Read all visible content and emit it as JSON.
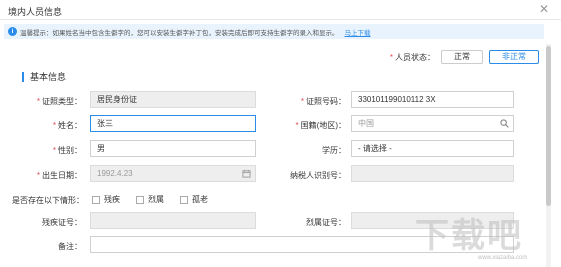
{
  "dialog": {
    "title": "境内人员信息",
    "close_glyph": "✕"
  },
  "notice": {
    "icon_glyph": "i",
    "text": "温馨提示：如果姓名当中包含生僻字的，您可以安装生僻字补丁包，安装完成后即可支持生僻字的录入和显示。",
    "link": "马上下载"
  },
  "status": {
    "label": "人员状态：",
    "options": [
      "正常",
      "非正常"
    ],
    "selected": "非正常"
  },
  "section_title": "基本信息",
  "form": {
    "id_type": {
      "label": "证照类型：",
      "value": "居民身份证",
      "required": true
    },
    "id_number": {
      "label": "证照号码：",
      "value": "330101199010112 3X",
      "required": true
    },
    "name": {
      "label": "姓名：",
      "value": "张三",
      "required": true
    },
    "nationality": {
      "label": "国籍(地区)：",
      "value": "中国",
      "required": true,
      "icon": "search-icon"
    },
    "gender": {
      "label": "性别：",
      "value": "男",
      "required": true
    },
    "education": {
      "label": "学历：",
      "value": "- 请选择 -",
      "required": false
    },
    "birth_date": {
      "label": "出生日期：",
      "value": "1992.4.23",
      "required": true,
      "icon": "calendar-icon"
    },
    "tax_id": {
      "label": "纳税人识别号：",
      "value": "",
      "required": false
    },
    "situation": {
      "label": "是否存在以下情形：",
      "options": [
        "残疾",
        "烈属",
        "孤老"
      ]
    },
    "disability_cert": {
      "label": "残疾证号：",
      "value": ""
    },
    "martyr_cert": {
      "label": "烈属证号：",
      "value": ""
    },
    "remarks": {
      "label": "备注：",
      "value": ""
    }
  },
  "watermark": {
    "text": "下载吧",
    "sub": "www.xiazaiba.com"
  },
  "colors": {
    "accent": "#2a8ce8",
    "required": "#e24d4d",
    "notice_bg": "#e8f3fd",
    "disabled_bg": "#eeeeee"
  }
}
